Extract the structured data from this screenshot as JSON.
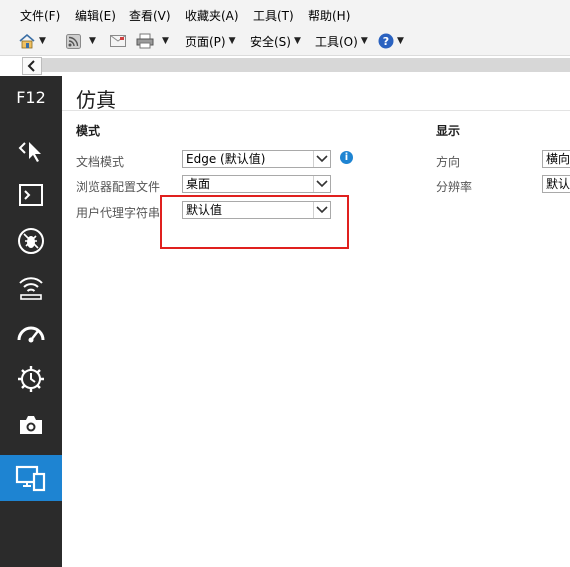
{
  "menu": [
    "文件(F)",
    "编辑(E)",
    "查看(V)",
    "收藏夹(A)",
    "工具(T)",
    "帮助(H)"
  ],
  "toolbar": {
    "page_label": "页面(P)",
    "safety_label": "安全(S)",
    "tools_label": "工具(O)"
  },
  "rail": {
    "title": "F12",
    "items": [
      "dom-explorer-icon",
      "console-icon",
      "debugger-icon",
      "network-icon",
      "performance-icon",
      "memory-icon",
      "screenshot-icon",
      "emulation-icon"
    ],
    "active": "emulation-icon"
  },
  "panel": {
    "title": "仿真",
    "mode": {
      "heading": "模式",
      "document_mode_label": "文档模式",
      "document_mode_value": "Edge (默认值)",
      "browser_profile_label": "浏览器配置文件",
      "browser_profile_value": "桌面",
      "user_agent_label": "用户代理字符串",
      "user_agent_value": "默认值"
    },
    "display": {
      "heading": "显示",
      "orientation_label": "方向",
      "orientation_value": "横向",
      "resolution_label": "分辨率",
      "resolution_value": "默认"
    }
  },
  "colors": {
    "accent": "#1e84d2",
    "highlight": "#e0201e",
    "rail_bg": "#2b2b2b"
  }
}
